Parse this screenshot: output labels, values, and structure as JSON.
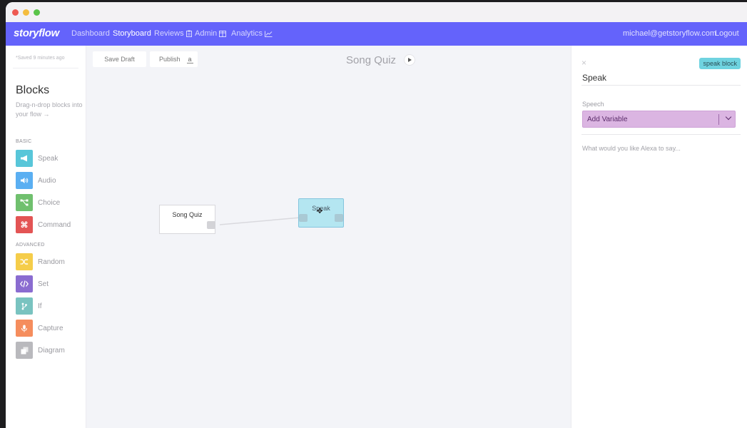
{
  "nav": {
    "logo": "storyflow",
    "links": [
      {
        "label": "Dashboard",
        "active": false
      },
      {
        "label": "Storyboard",
        "active": true
      },
      {
        "label": "Reviews",
        "active": false,
        "icon": "clipboard-icon"
      },
      {
        "label": "Admin",
        "active": false,
        "icon": "table-icon"
      },
      {
        "label": "Analytics",
        "active": false,
        "icon": "chart-icon"
      }
    ],
    "email": "michael@getstoryflow.com",
    "logout": "Logout"
  },
  "sidebar": {
    "saved_status": "*Saved 9 minutes ago",
    "title": "Blocks",
    "subtitle": "Drag-n-drop blocks into your flow",
    "basic_label": "BASIC",
    "advanced_label": "ADVANCED",
    "basic_blocks": [
      {
        "label": "Speak",
        "icon": "megaphone-icon",
        "color": "#58c6d9"
      },
      {
        "label": "Audio",
        "icon": "speaker-icon",
        "color": "#5aaff2"
      },
      {
        "label": "Choice",
        "icon": "branch-icon",
        "color": "#70c06e"
      },
      {
        "label": "Command",
        "icon": "command-icon",
        "color": "#e35454"
      }
    ],
    "advanced_blocks": [
      {
        "label": "Random",
        "icon": "shuffle-icon",
        "color": "#f5cd4a"
      },
      {
        "label": "Set",
        "icon": "code-icon",
        "color": "#8a6cd0"
      },
      {
        "label": "If",
        "icon": "fork-icon",
        "color": "#79c3c0"
      },
      {
        "label": "Capture",
        "icon": "microphone-icon",
        "color": "#f58d5d"
      },
      {
        "label": "Diagram",
        "icon": "layers-icon",
        "color": "#b9b9bd"
      }
    ]
  },
  "canvas": {
    "save_draft": "Save Draft",
    "publish": "Publish",
    "publish_shortcut": "a",
    "title": "Song Quiz",
    "nodes": {
      "start": "Song Quiz",
      "speak": "Speak"
    }
  },
  "panel": {
    "close": "×",
    "badge": "speak block",
    "title": "Speak",
    "speech_label": "Speech",
    "add_variable": "Add Variable",
    "speech_placeholder": "What would you like Alexa to say...",
    "colors": {
      "badge": "#6fd3e0",
      "variable": "#dbb5e2"
    }
  },
  "theme": {
    "nav_bg": "#6463fb"
  }
}
